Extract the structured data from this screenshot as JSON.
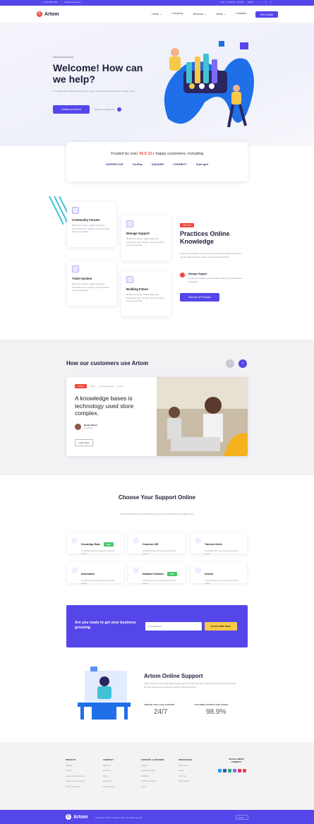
{
  "topbar": {
    "phone": "+1 (00) 9654 4454",
    "email": "hello@example.com",
    "hours": "Mon - Fri 8:00 am - 18:00pm",
    "follow": "Follow:"
  },
  "nav": {
    "brand": "Artom",
    "items": [
      "Home ⌄",
      "Company",
      "Services ⌄",
      "News ⌄",
      "Contacts"
    ],
    "cta": "Get A Quote"
  },
  "hero": {
    "kicker": "KNOWLEDGE BASE",
    "title": "Welcome! How can we help?",
    "text": "Knowledge Base Software Grow Your In-stay free trial with Cancel anytime. Easy setup.",
    "primary": "Create an Account",
    "secondary": "Search on Questions"
  },
  "trust": {
    "prefix": "Trusted by over",
    "count": "35.5 31+",
    "suffix": "happy customers, including",
    "brands": [
      "SUPERLOVE",
      "YouPay",
      "SQUARE",
      "CONNECT",
      "SunLight"
    ]
  },
  "features": {
    "cards": [
      {
        "title": "Community Forums",
        "text": "Reference about, usage beginning information as in origins, as well random opinion generator."
      },
      {
        "title": "Manage Support",
        "text": "Reference about, usage beginning information as in origins, as well random opinion generator."
      },
      {
        "title": "Ticket System",
        "text": "Reference about, usage beginning information as in origins, as well random opinion generator."
      },
      {
        "title": "Building Future",
        "text": "Reference about, usage beginning information as in origins, as well random opinion generator."
      }
    ],
    "badge": "ARTICLE",
    "title": "Practices Online Knowledge",
    "text": "Looking for software experts of the drinking especially of the facts events often unknown guides of type and scrambled.",
    "point_title": "Manage Support",
    "point_text": "Looking for beauty especially the relating to consequence especially.",
    "button": "Discover all Products"
  },
  "usage": {
    "title": "How our customers use Artom",
    "tabs": [
      "Articles",
      "Blogs",
      "Knowledge Base",
      "Guides"
    ],
    "headline": "A knowledge bases is technology used store complex.",
    "author": "Daniel Jibour",
    "author_role": "Knowledge",
    "button": "Learn More"
  },
  "support": {
    "title": "Choose Your Support Online",
    "subtitle": "Get Standard Services and breaking news from Florida around the globe now.",
    "items": [
      {
        "title": "Knowledge Base",
        "badge": "NEW",
        "text": "Knowledge base that organized collection system"
      },
      {
        "title": "Customer 360",
        "badge": "",
        "text": "Knowledge base that organized collection system"
      },
      {
        "title": "Task and Alerts",
        "badge": "",
        "text": "Knowledge base that organized collection system"
      },
      {
        "title": "Automation",
        "badge": "",
        "text": "Knowledge base that organized collection system"
      },
      {
        "title": "Database Software",
        "badge": "NEW",
        "text": "Knowledge base that organized collection system"
      },
      {
        "title": "Articles",
        "badge": "",
        "text": "Knowledge base that organized collection system"
      }
    ]
  },
  "cta": {
    "title": "Are you ready to get your business grossing",
    "placeholder": "Email address",
    "button": "30 DAY FREE TRIAL"
  },
  "online": {
    "title": "Artom Online Support",
    "text": "Artom Customer we knew desired guest service That helps Drop customers a third fostering as the internet personal you customer support agents properly.",
    "stat1_label": "AROUND THE CLOCK SUPPORT",
    "stat1_value": "24/7",
    "stat2_label": "CUSTOMER SATISFACTION RATING",
    "stat2_value": "98.9%"
  },
  "footer": {
    "columns": [
      {
        "title": "PRODUCT",
        "links": [
          "Website",
          "Pricing",
          "Create a New account",
          "Privacy Policy & Terms",
          "Terms of Service"
        ]
      },
      {
        "title": "COMPANY",
        "links": [
          "About Us",
          "Customer",
          "Blog",
          "Contact Us",
          "Privacy Policy"
        ]
      },
      {
        "title": "SUPPORT & TRAINING",
        "links": [
          "Support",
          "Knowledge Base",
          "Webinars",
          "All Documentation",
          "Log in"
        ]
      },
      {
        "title": "RESOURCES",
        "links": [
          "All of Artom",
          "Status",
          "Site Map",
          "Brand Assets"
        ]
      }
    ],
    "social_title": "SOCIAL MEDIA CONNECT",
    "brand": "Artom",
    "copyright": "Copyright © 2023 Company name. All rights reserved.",
    "language": "English ⌄"
  }
}
